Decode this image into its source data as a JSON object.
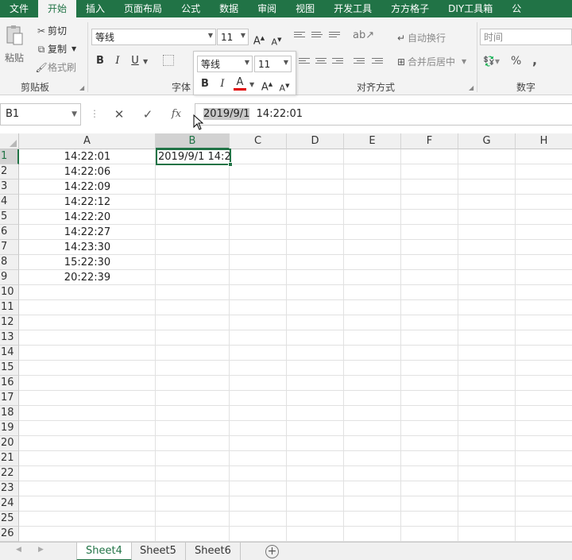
{
  "menu": {
    "tabs": [
      "文件",
      "开始",
      "插入",
      "页面布局",
      "公式",
      "数据",
      "审阅",
      "视图",
      "开发工具",
      "方方格子",
      "DIY工具箱",
      "公"
    ],
    "active_index": 1
  },
  "ribbon": {
    "clipboard": {
      "paste_label": "粘贴",
      "cut_label": "剪切",
      "copy_label": "复制",
      "format_painter_label": "格式刷",
      "group_label": "剪贴板"
    },
    "font": {
      "font_name": "等线",
      "font_size": "11",
      "bold": "B",
      "italic": "I",
      "underline": "U",
      "grow": "A",
      "shrink": "A",
      "color_letter": "A",
      "group_label": "字体"
    },
    "alignment": {
      "wrap_text_label": "自动换行",
      "merge_label": "合并后居中",
      "group_label": "对齐方式"
    },
    "number": {
      "format_value": "时间",
      "percent": "%",
      "comma": ",",
      "group_label": "数字"
    },
    "accent_color": "#217346",
    "font_color_bar": "#e00000"
  },
  "formula_bar": {
    "name_box": "B1",
    "cancel_icon": "✕",
    "enter_icon": "✓",
    "fx": "fx",
    "content_selected": "2019/9/1",
    "content_rest": "  14:22:01"
  },
  "grid": {
    "columns": [
      "A",
      "B",
      "C",
      "D",
      "E",
      "F",
      "G",
      "H"
    ],
    "selected_column": "B",
    "rows": [
      "1",
      "2",
      "3",
      "4",
      "5",
      "6",
      "7",
      "8",
      "9",
      "10",
      "11",
      "12",
      "13",
      "14",
      "15",
      "16",
      "17",
      "18",
      "19",
      "20",
      "21",
      "22",
      "23",
      "24",
      "25",
      "26"
    ],
    "selected_row": "1",
    "col_a_values": [
      "14:22:01",
      "14:22:06",
      "14:22:09",
      "14:22:12",
      "14:22:20",
      "14:22:27",
      "14:23:30",
      "15:22:30",
      "20:22:39"
    ],
    "b1_value": "2019/9/1  14:2"
  },
  "sheet_tabs": {
    "tabs": [
      "Sheet4",
      "Sheet5",
      "Sheet6"
    ],
    "active": "Sheet4",
    "add_icon": "+"
  }
}
